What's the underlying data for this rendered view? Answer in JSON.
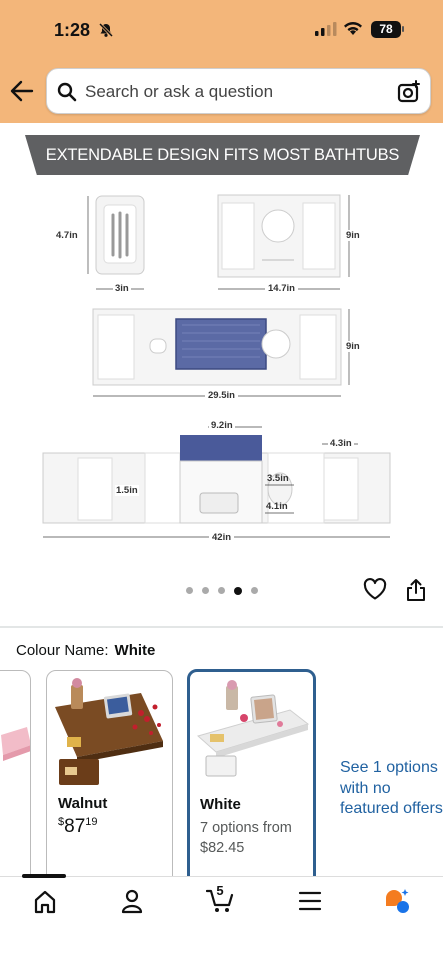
{
  "status_bar": {
    "time": "1:28",
    "battery": "78"
  },
  "search": {
    "placeholder": "Search or ask a question"
  },
  "product_image": {
    "banner": "EXTENDABLE DESIGN FITS MOST BATHTUBS",
    "dimensions": {
      "soap_height": "4.7in",
      "soap_width": "3in",
      "tray_width": "14.7in",
      "tray_depth": "9in",
      "expanded_width": "29.5in",
      "expanded_depth": "9in",
      "holder_width": "9.2in",
      "end_width": "4.3in",
      "slot_height": "1.5in",
      "cup_diameter": "3.5in",
      "cup_small": "4.1in",
      "full_width": "42in"
    },
    "carousel_total": 5,
    "carousel_active": 4
  },
  "variation": {
    "label": "Colour Name:",
    "selected": "White"
  },
  "cards": [
    {
      "name": "Walnut",
      "price_symbol": "$",
      "price_whole": "87",
      "price_fraction": "19"
    },
    {
      "name": "White",
      "options_text": "7 options from",
      "options_price": "$82.45"
    }
  ],
  "see_options": "See 1 options with no featured offers",
  "bottom_nav": {
    "cart_count": "5",
    "items": [
      "home-icon",
      "account-icon",
      "cart-icon",
      "menu-icon",
      "rufus-icon"
    ]
  },
  "colors": {
    "header_bg": "#f3b67a",
    "selected_border": "#2f5f8f",
    "link": "#2162a1",
    "banner_bg": "#5f6062",
    "tray_blue": "#5b6aa5"
  }
}
